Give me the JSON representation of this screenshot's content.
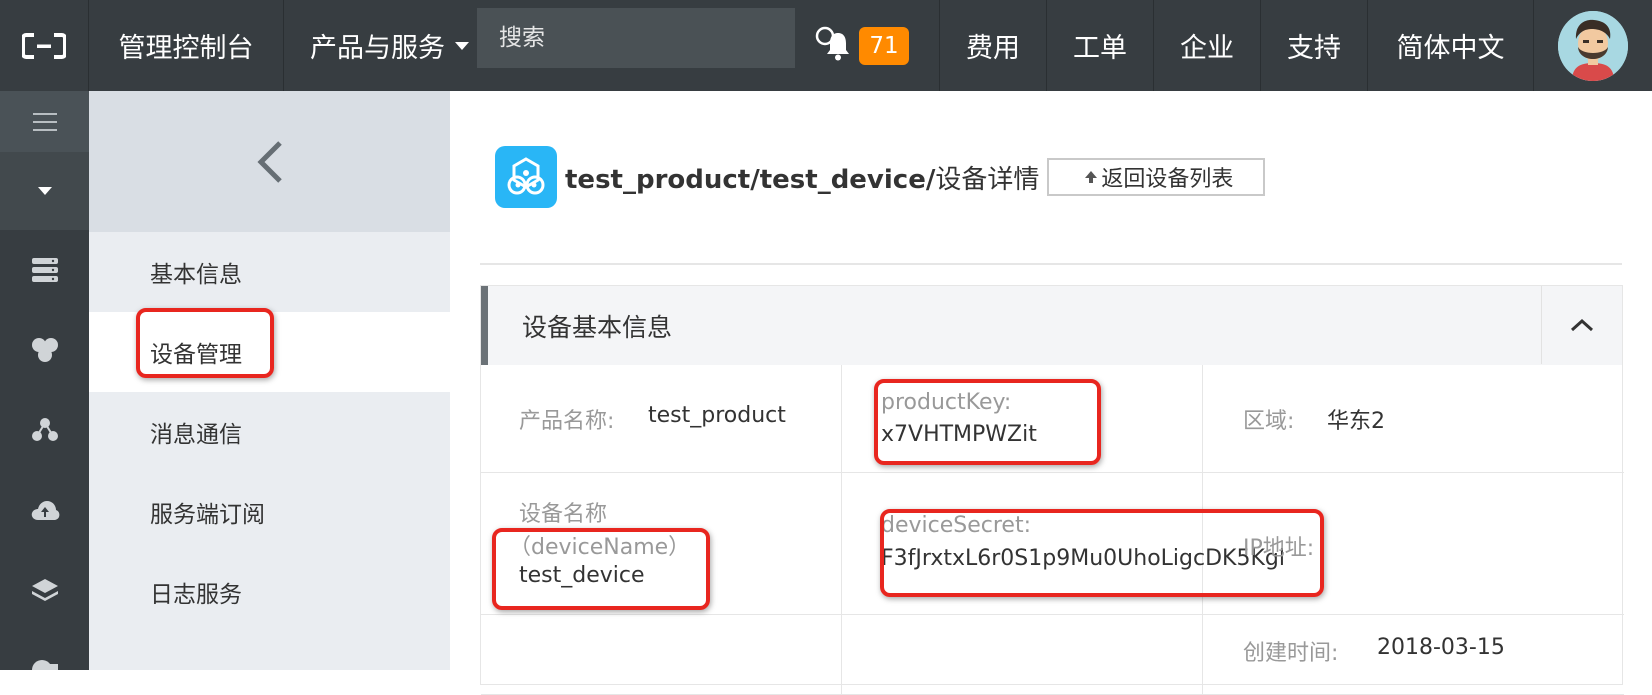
{
  "topbar": {
    "console_label": "管理控制台",
    "products_label": "产品与服务",
    "search_placeholder": "搜索",
    "notification_count": "71",
    "items": [
      "费用",
      "工单",
      "企业",
      "支持",
      "简体中文"
    ]
  },
  "rail": {
    "icons": [
      "menu-icon",
      "caret-down-icon",
      "server-icon",
      "iot-hub-icon",
      "network-icon",
      "cloud-icon",
      "layers-icon"
    ]
  },
  "sidebar": {
    "items": [
      {
        "label": "基本信息"
      },
      {
        "label": "设备管理"
      },
      {
        "label": "消息通信"
      },
      {
        "label": "服务端订阅"
      },
      {
        "label": "日志服务"
      }
    ]
  },
  "header": {
    "title_path": "test_product/test_device/",
    "title_suffix": "设备详情",
    "back_label": "返回设备列表"
  },
  "panel": {
    "title": "设备基本信息",
    "fields": {
      "product_name_label": "产品名称:",
      "product_name_value": "test_product",
      "product_key_label": "productKey:",
      "product_key_value": "x7VHTMPWZit",
      "region_label": "区域:",
      "region_value": "华东2",
      "device_name_label_1": "设备名称",
      "device_name_label_2": "（deviceName）",
      "device_name_value": "test_device",
      "device_secret_label": "deviceSecret:",
      "device_secret_value": "F3fJrxtxL6r0S1p9Mu0UhoLigcDK5Kgl",
      "ip_label": "IP地址:",
      "created_label": "创建时间:",
      "created_value": "2018-03-15"
    }
  },
  "colors": {
    "topbar_bg": "#373d41",
    "badge": "#ff8a00",
    "highlight": "#e8261f",
    "product_icon": "#29b6f6"
  }
}
